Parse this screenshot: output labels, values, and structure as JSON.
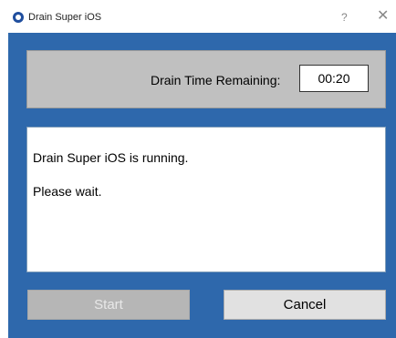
{
  "window": {
    "title": "Drain Super iOS",
    "help_glyph": "?",
    "close_glyph": "✕"
  },
  "timer": {
    "label": "Drain Time Remaining:",
    "value": "00:20"
  },
  "status": {
    "line1": "Drain Super iOS is running.",
    "line2": "Please wait."
  },
  "buttons": {
    "start_label": "Start",
    "start_enabled": false,
    "cancel_label": "Cancel"
  },
  "colors": {
    "client_background": "#2e68ac",
    "panel_gray": "#c0c0c0",
    "disabled_button": "#b6b6b6",
    "button_face": "#e1e1e1"
  },
  "icons": {
    "app_icon": "app-circle-icon"
  }
}
